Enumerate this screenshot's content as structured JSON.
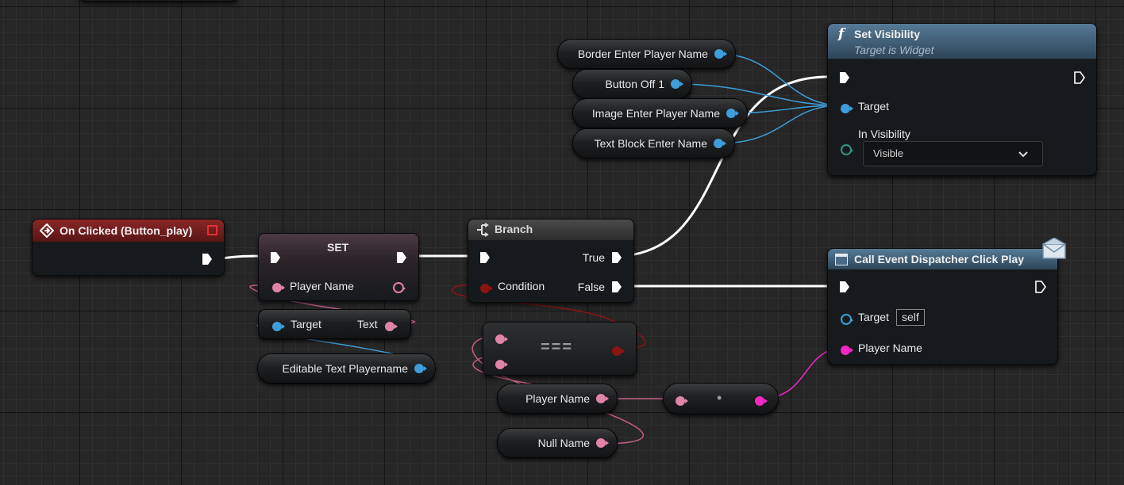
{
  "event_node": {
    "title": "On Clicked (Button_play)"
  },
  "set_node": {
    "title": "SET",
    "pin_label": "Player Name"
  },
  "get_text_node": {
    "target_label": "Target",
    "text_label": "Text"
  },
  "editable_var": {
    "label": "Editable Text Playername"
  },
  "branch_node": {
    "title": "Branch",
    "condition_label": "Condition",
    "true_label": "True",
    "false_label": "False"
  },
  "equal_node": {
    "symbol": "==="
  },
  "player_name_var": {
    "label": "Player Name"
  },
  "null_name_var": {
    "label": "Null Name"
  },
  "reroute_node": {
    "symbol": "•"
  },
  "widget_vars": [
    {
      "label": "Border Enter Player Name"
    },
    {
      "label": "Button Off 1"
    },
    {
      "label": "Image Enter Player Name"
    },
    {
      "label": "Text Block Enter Name"
    }
  ],
  "set_visibility_node": {
    "title": "Set Visibility",
    "subtitle": "Target is Widget",
    "func_icon": "f",
    "target_label": "Target",
    "in_visibility_label": "In Visibility",
    "in_visibility_value": "Visible"
  },
  "dispatcher_node": {
    "title": "Call Event Dispatcher Click Play",
    "target_label": "Target",
    "target_value": "self",
    "player_name_label": "Player Name"
  },
  "colors": {
    "exec_wire": "#ffffff",
    "object_pin": "#3f9ed9",
    "string_pin": "#e084a6",
    "name_pin": "#f228c6",
    "bool_pin": "#8a1512",
    "event_header": "#7a1c1c",
    "function_header": "#3d5f7a",
    "set_header": "#8c6a7a"
  },
  "icons": {
    "event": "event-diamond-icon",
    "branch": "branch-icon",
    "function": "function-icon",
    "dispatcher": "dispatcher-icon",
    "message": "envelope-icon",
    "dropdown": "chevron-down-icon",
    "stop": "stop-icon"
  }
}
